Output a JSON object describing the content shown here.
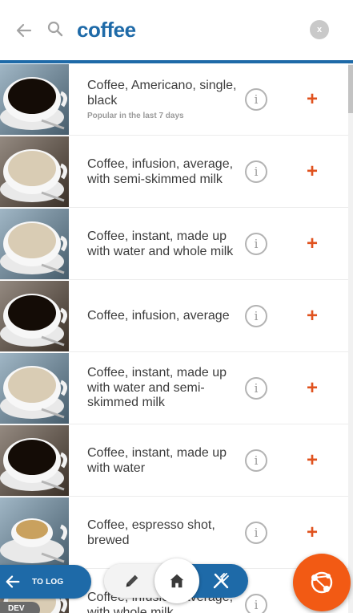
{
  "header": {
    "search_value": "coffee",
    "clear_label": "x"
  },
  "results": [
    {
      "name": "Coffee, Americano, single, black",
      "sub": "Popular in the last 7 days",
      "photo": "black-coffee-cup-icon"
    },
    {
      "name": "Coffee, infusion, average, with semi-skimmed milk",
      "sub": "",
      "photo": "milky-coffee-cup-icon"
    },
    {
      "name": "Coffee, instant, made up with water and whole milk",
      "sub": "",
      "photo": "milky-coffee-cup-icon"
    },
    {
      "name": "Coffee, infusion, average",
      "sub": "",
      "photo": "black-coffee-cup-icon"
    },
    {
      "name": "Coffee, instant, made up with water and semi-skimmed milk",
      "sub": "",
      "photo": "milky-coffee-cup-icon"
    },
    {
      "name": "Coffee, instant, made up with water",
      "sub": "",
      "photo": "black-coffee-cup-icon"
    },
    {
      "name": "Coffee, espresso shot, brewed",
      "sub": "",
      "photo": "espresso-cup-icon"
    },
    {
      "name": "Coffee, infusion, average, with whole milk",
      "sub": "",
      "photo": "milky-coffee-cup-icon"
    }
  ],
  "row_actions": {
    "info_label": "i",
    "add_label": "+"
  },
  "bottom_bar": {
    "to_log_label": "TO LOG",
    "dev_label": "DEV"
  },
  "colors": {
    "brand_blue": "#1e6aa8",
    "accent_orange": "#e0521e",
    "fab_orange": "#f25a14"
  },
  "icons": {
    "back": "back-arrow-icon",
    "search": "search-icon",
    "edit": "pencil-icon",
    "home": "home-icon",
    "meals": "fork-knife-icon",
    "share": "share-network-icon"
  }
}
